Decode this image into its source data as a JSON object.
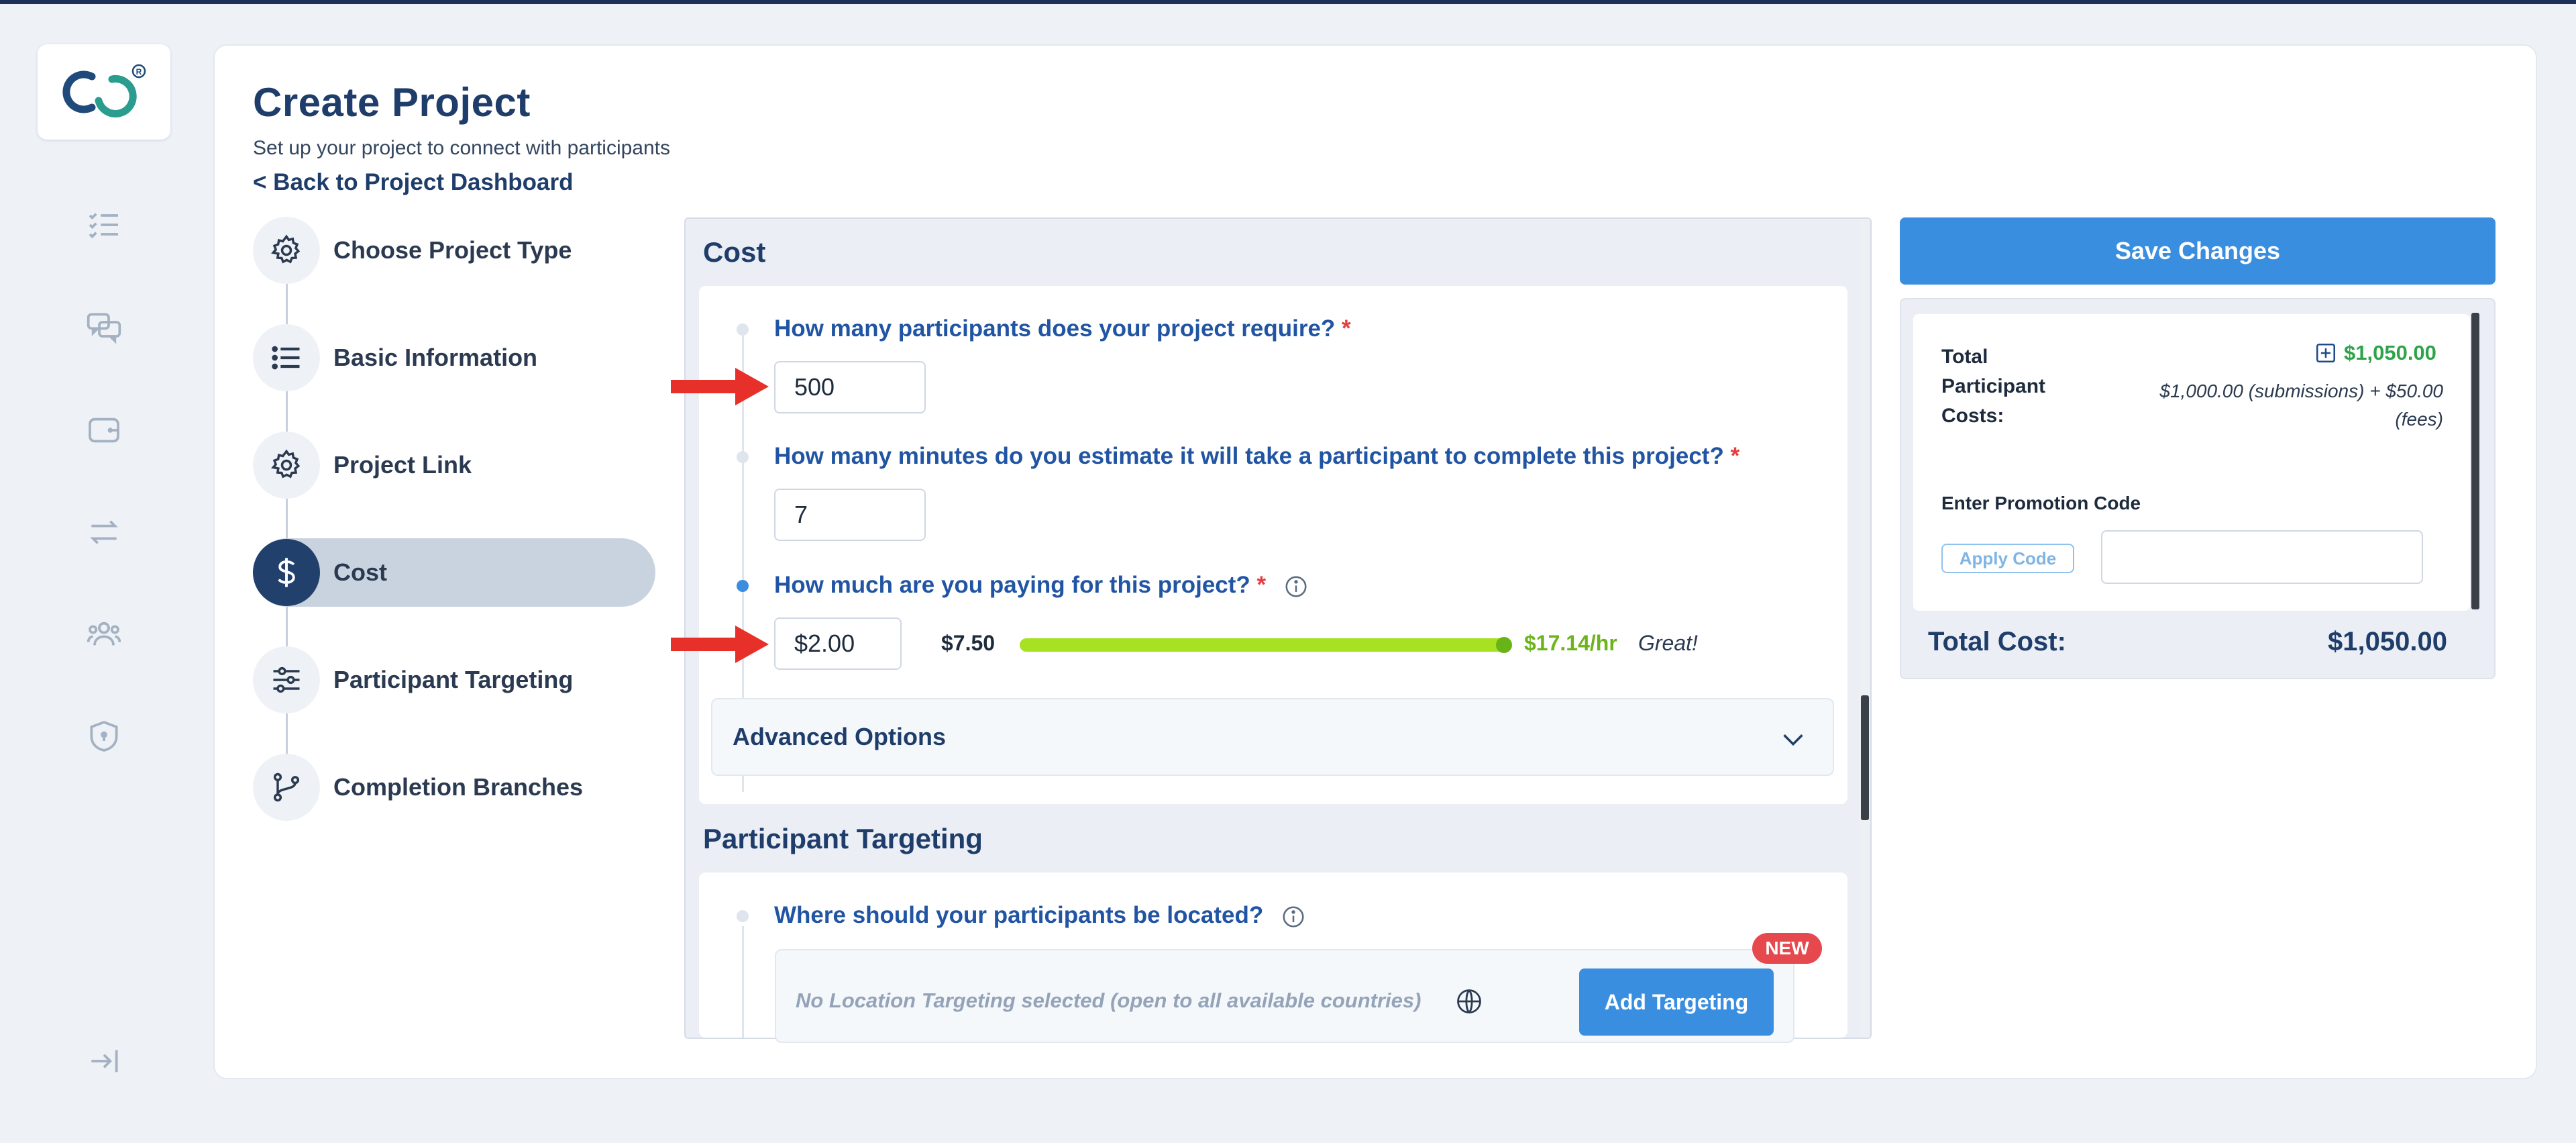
{
  "page": {
    "title": "Create Project",
    "subtitle": "Set up your project to connect with participants",
    "back_link": "< Back to Project Dashboard"
  },
  "sidebar": {
    "icons": [
      "tasks-icon",
      "chat-icon",
      "wallet-icon",
      "transfer-icon",
      "users-icon",
      "shield-icon"
    ],
    "collapse_icon": "collapse-icon"
  },
  "steps": [
    {
      "label": "Choose Project Type",
      "icon": "gear-icon",
      "active": false
    },
    {
      "label": "Basic Information",
      "icon": "list-icon",
      "active": false
    },
    {
      "label": "Project Link",
      "icon": "gear-icon",
      "active": false
    },
    {
      "label": "Cost",
      "icon": "dollar-icon",
      "active": true
    },
    {
      "label": "Participant Targeting",
      "icon": "sliders-icon",
      "active": false
    },
    {
      "label": "Completion Branches",
      "icon": "branch-icon",
      "active": false
    }
  ],
  "cost": {
    "section_title": "Cost",
    "q_participants": "How many participants does your project require?",
    "participants_value": "500",
    "q_minutes": "How many minutes do you estimate it will take a participant to complete this project?",
    "minutes_value": "7",
    "q_paying": "How much are you paying for this project?",
    "paying_value": "$2.00",
    "rate_min": "$7.50",
    "rate_value": "$17.14/hr",
    "rate_tag": "Great!",
    "rate_level": 1.0,
    "required_mark": "*",
    "advanced_options": "Advanced Options"
  },
  "targeting": {
    "section_title": "Participant Targeting",
    "q_location": "Where should your participants be located?",
    "location_text": "No Location Targeting selected (open to all available countries)",
    "add_button": "Add Targeting",
    "new_badge": "NEW"
  },
  "summary": {
    "save_button": "Save Changes",
    "total_participant_costs_label": "Total Participant Costs:",
    "total_participant_costs": "$1,050.00",
    "costs_detail": "$1,000.00 (submissions) + $50.00 (fees)",
    "promo_label": "Enter Promotion Code",
    "apply_code": "Apply Code",
    "total_cost_label": "Total Cost:",
    "total_cost": "$1,050.00"
  },
  "colors": {
    "brand": "#1f3d6a",
    "accent": "#3a8ee0",
    "success": "#2fa34a",
    "required": "#e53e3e",
    "arrow": "#e8302a"
  }
}
